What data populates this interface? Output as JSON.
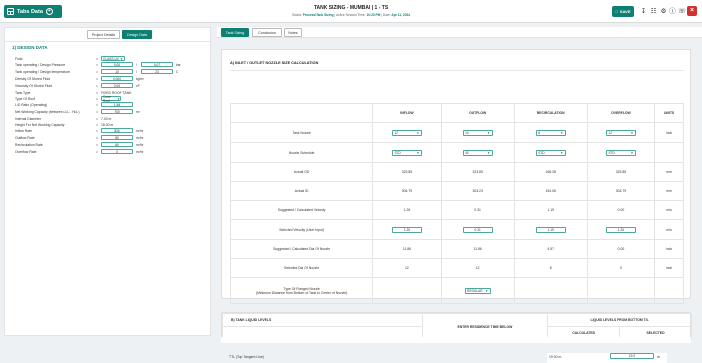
{
  "header": {
    "brand": "Tabs Data",
    "title": "TANK SIZING - MUMBAI | 1 - TS",
    "sub_prefix": "Status:",
    "sub_status": "Process/Tank Sizing",
    "sub_mid": "Active Session Time:",
    "sub_time": "10:23 PM",
    "sub_date_label": "Date:",
    "sub_date": "Apr 11, 2024",
    "save_label": "SAVE"
  },
  "left": {
    "tabs": [
      "Project Details",
      "Design Data"
    ],
    "section": "1) DESIGN DATA",
    "rows": [
      {
        "label": "Fluid",
        "value": "CLASS-UV"
      },
      {
        "label": "Tank operating / Design Pressure",
        "v1": "0.00",
        "v2": "0.07",
        "unit": "bar"
      },
      {
        "label": "Tank operating / Design temperature",
        "v1": "10",
        "v2": "23",
        "unit": "C"
      },
      {
        "label": "Density Of Stored Fluid",
        "v1": "0.000",
        "unit": "kg/m³"
      },
      {
        "label": "Viscosity Of Stored Fluid",
        "v1": "0.00",
        "unit": "cP"
      },
      {
        "label": "Tank Type",
        "value": "FIXED ROOF TANK"
      },
      {
        "label": "Type Of Roof",
        "value": "Cone Roof"
      },
      {
        "label": "L/D Ratio (Operating)",
        "v1": "1.98"
      },
      {
        "label": "Net Working Capacity (between LLL - HLL)",
        "v1": "700",
        "unit": "m³"
      },
      {
        "label": "Internal Diameter",
        "value": "7.00  m"
      },
      {
        "label": "Height For Net Working Capacity",
        "value": "18.00  m"
      },
      {
        "label": "Inflow Rate",
        "v1": "830",
        "unit": "m³/hr"
      },
      {
        "label": "Outflow Rate",
        "v1": "80",
        "unit": "m³/hr"
      },
      {
        "label": "Recirculation Rate",
        "v1": "80",
        "unit": "m³/hr"
      },
      {
        "label": "Overflow Rate",
        "v1": "0",
        "unit": "m³/hr"
      }
    ]
  },
  "right": {
    "tabs": [
      "Tank Sizing",
      "Conclusion",
      "Notes"
    ],
    "section_a": "A) INLET / OUTLET NOZZLE SIZE CALCULATION",
    "columns": [
      "INFLOW",
      "OUTFLOW",
      "RECIRCULATION",
      "OVERFLOW",
      "UNITS"
    ],
    "rows": [
      {
        "label": "Tank Nozzle",
        "kind": "select",
        "cells": [
          "12",
          "10",
          "8",
          "12"
        ],
        "unit": "inch"
      },
      {
        "label": "Nozzle Schedule",
        "kind": "select",
        "cells": [
          "STD",
          "40",
          "STD",
          "STD"
        ],
        "unit": ""
      },
      {
        "label": "Actual OD",
        "kind": "text",
        "cells": [
          "323.85",
          "323.85",
          "168.28",
          "323.85"
        ],
        "unit": "mm"
      },
      {
        "label": "Actual ID",
        "kind": "text",
        "cells": [
          "304.79",
          "303.23",
          "154.06",
          "304.79"
        ],
        "unit": "mm"
      },
      {
        "label": "Suggested / Calculated Velocity",
        "kind": "text",
        "cells": [
          "1.26",
          "0.31",
          "1.19",
          "0.00"
        ],
        "unit": "m/s"
      },
      {
        "label": "Selected Velocity (User Input)",
        "kind": "input",
        "cells": [
          "1.26",
          "0.31",
          "1.19",
          "1.26"
        ],
        "unit": "m/s"
      },
      {
        "label": "Suggested / Calculated Dia Of Nozzle",
        "kind": "text",
        "cells": [
          "11.86",
          "11.86",
          "4.57",
          "0.00"
        ],
        "unit": "inch"
      },
      {
        "label": "Selected Dia Of Nozzle",
        "kind": "text",
        "cells": [
          "12",
          "12",
          "8",
          "0"
        ],
        "unit": "inch"
      },
      {
        "label": "Type Of Flanged Nozzle",
        "label2": "(Minimum Distance from Bottom of Tank to Center of Nozzle)",
        "kind": "flange",
        "cells": [
          "",
          "REGULAR",
          "",
          ""
        ],
        "unit": ""
      }
    ],
    "section_b": "B) TANK LIQUID LEVELS",
    "levels_header_mid": "ENTER RESIDENCE TIME BELOW",
    "levels_header_right": "LIQUID LEVELS FROM BOTTOM T/L",
    "levels_sub": [
      "CALCULATED",
      "SELECTED"
    ],
    "levels_row": {
      "label": "TTL (Top Tangent Line)",
      "calc": "19.00",
      "calc_unit": "m",
      "sel": "19.0",
      "sel_unit": "m"
    }
  }
}
